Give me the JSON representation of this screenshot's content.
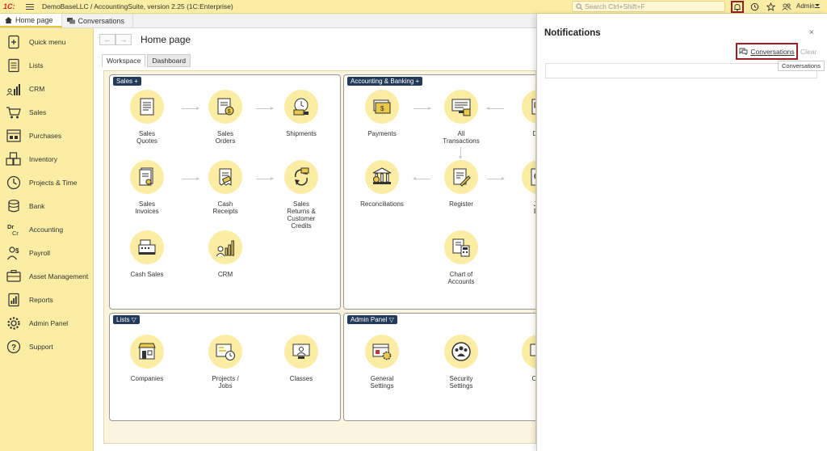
{
  "app": {
    "logo": "1C:",
    "title": "DemoBaseLLC / AccountingSuite, version 2.25  (1C:Enterprise)",
    "search_placeholder": "Search Ctrl+Shift+F",
    "user": "Admin"
  },
  "tabs": [
    {
      "label": "Home page",
      "icon": "home-icon"
    },
    {
      "label": "Conversations",
      "icon": "conversations-icon"
    }
  ],
  "sidebar": {
    "items": [
      {
        "label": "Quick menu",
        "icon": "quick-menu-icon"
      },
      {
        "label": "Lists",
        "icon": "lists-icon"
      },
      {
        "label": "CRM",
        "icon": "crm-icon"
      },
      {
        "label": "Sales",
        "icon": "sales-icon"
      },
      {
        "label": "Purchases",
        "icon": "purchases-icon"
      },
      {
        "label": "Inventory",
        "icon": "inventory-icon"
      },
      {
        "label": "Projects & Time",
        "icon": "projects-time-icon"
      },
      {
        "label": "Bank",
        "icon": "bank-icon"
      },
      {
        "label": "Accounting",
        "icon": "accounting-icon"
      },
      {
        "label": "Payroll",
        "icon": "payroll-icon"
      },
      {
        "label": "Asset Management",
        "icon": "asset-management-icon"
      },
      {
        "label": "Reports",
        "icon": "reports-icon"
      },
      {
        "label": "Admin Panel",
        "icon": "admin-panel-icon"
      },
      {
        "label": "Support",
        "icon": "support-icon"
      }
    ]
  },
  "main": {
    "title": "Home page",
    "subtabs": [
      "Workspace",
      "Dashboard"
    ],
    "panels": {
      "sales": {
        "tag": "Sales +",
        "tiles": [
          "Sales\nQuotes",
          "Sales\nOrders",
          "Shipments",
          "Sales\nInvoices",
          "Cash\nReceipts",
          "Sales\nReturns &\nCustomer\nCredits",
          "Cash Sales",
          "CRM"
        ]
      },
      "accounting": {
        "tag": "Accounting & Banking +",
        "tiles": [
          "Payments",
          "All\nTransactions",
          "Dep",
          "Reconciliations",
          "Register",
          "Jou\nEnt",
          "Chart of\nAccounts"
        ]
      },
      "lists": {
        "tag": "Lists ▽",
        "tiles": [
          "Companies",
          "Projects /\nJobs",
          "Classes"
        ]
      },
      "admin": {
        "tag": "Admin Panel ▽",
        "tiles": [
          "General\nSettings",
          "Security\nSettings",
          "Com\nIn"
        ]
      }
    }
  },
  "notifications": {
    "title": "Notifications",
    "close": "×",
    "conversations_button": "Conversations",
    "clear_button": "Clear",
    "tooltip": "Conversations"
  }
}
